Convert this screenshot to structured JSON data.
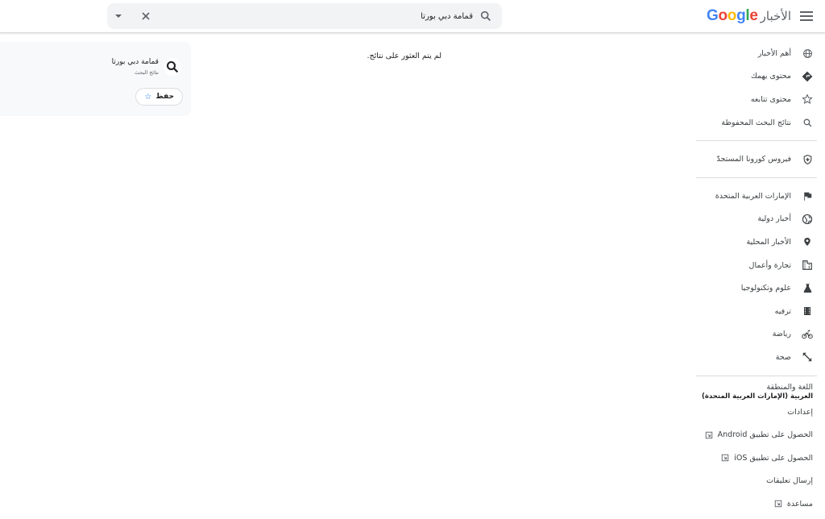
{
  "header": {
    "logo_text": "Google",
    "logo_news": "الأخبار",
    "search_value": "قمامة دبي بورتا",
    "menu_icon": "hamburger-menu-icon"
  },
  "main": {
    "no_results": "لم يتم العثور على نتائج."
  },
  "saved_search_card": {
    "title": "قمامة دبي بورتا",
    "subtitle": "نتائج البحث",
    "save_label": "حفظ"
  },
  "sidebar": {
    "section1": [
      {
        "label": "أهم الأخبار",
        "icon": "globe-icon"
      },
      {
        "label": "محتوى يهمك",
        "icon": "diamond-icon"
      },
      {
        "label": "محتوى تتابعه",
        "icon": "star-icon"
      },
      {
        "label": "نتائج البحث المحفوظة",
        "icon": "search-icon"
      }
    ],
    "section2": [
      {
        "label": "فيروس كورونا المستجدّ",
        "icon": "shield-plus-icon"
      }
    ],
    "section3": [
      {
        "label": "الإمارات العربية المتحدة",
        "icon": "flag-icon"
      },
      {
        "label": "أخبار دولية",
        "icon": "world-icon"
      },
      {
        "label": "الأخبار المحلية",
        "icon": "location-pin-icon"
      },
      {
        "label": "تجارة وأعمال",
        "icon": "building-icon"
      },
      {
        "label": "علوم وتكنولوجيا",
        "icon": "flask-icon"
      },
      {
        "label": "ترفيه",
        "icon": "film-icon"
      },
      {
        "label": "رياضة",
        "icon": "bicycle-icon"
      },
      {
        "label": "صحة",
        "icon": "health-icon"
      }
    ],
    "language_title": "اللغة والمنطقة",
    "language_value": "العربية (الإمارات العربية المتحدة)",
    "settings": "إعدادات",
    "android_app": "الحصول على تطبيق Android",
    "ios_app": "الحصول على تطبيق iOS",
    "feedback": "إرسال تعليقات",
    "help": "مساعدة"
  },
  "colors": {
    "accent": "#1a73e8",
    "icon_gray": "#5f6368",
    "divider": "#dadce0"
  }
}
